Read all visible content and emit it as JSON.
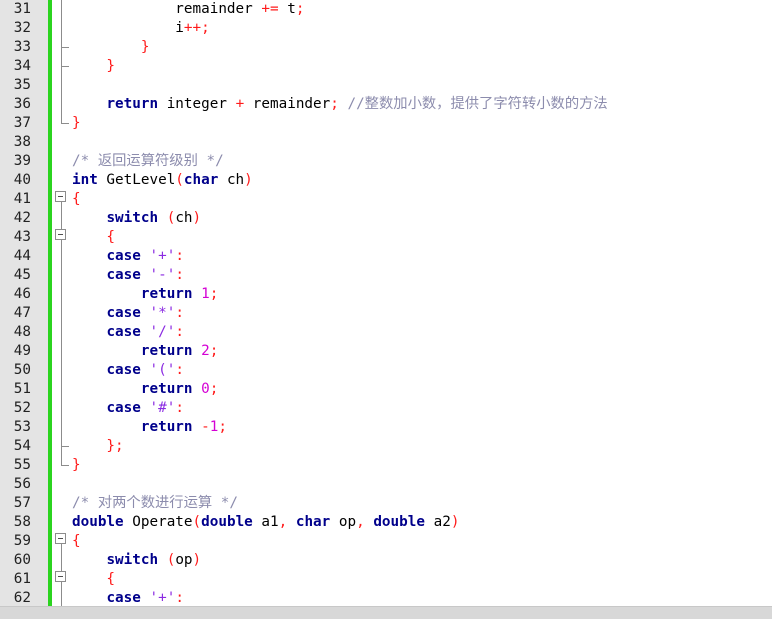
{
  "editor": {
    "lines": [
      {
        "n": "31",
        "t": [
          {
            "c": "",
            "v": "            remainder "
          },
          {
            "c": "op",
            "v": "+="
          },
          {
            "c": "",
            "v": " t"
          },
          {
            "c": "op",
            "v": ";"
          }
        ]
      },
      {
        "n": "32",
        "t": [
          {
            "c": "",
            "v": "            i"
          },
          {
            "c": "op",
            "v": "++;"
          }
        ]
      },
      {
        "n": "33",
        "t": [
          {
            "c": "op",
            "v": "        }"
          }
        ]
      },
      {
        "n": "34",
        "t": [
          {
            "c": "op",
            "v": "    }"
          }
        ]
      },
      {
        "n": "35",
        "t": []
      },
      {
        "n": "36",
        "t": [
          {
            "c": "",
            "v": "    "
          },
          {
            "c": "kw",
            "v": "return"
          },
          {
            "c": "",
            "v": " integer "
          },
          {
            "c": "op",
            "v": "+"
          },
          {
            "c": "",
            "v": " remainder"
          },
          {
            "c": "op",
            "v": ";"
          },
          {
            "c": "cm",
            "v": " //整数加小数，提供了字符转小数的方法"
          }
        ]
      },
      {
        "n": "37",
        "t": [
          {
            "c": "op",
            "v": "}"
          }
        ]
      },
      {
        "n": "38",
        "t": []
      },
      {
        "n": "39",
        "t": [
          {
            "c": "cm",
            "v": "/* 返回运算符级别 */"
          }
        ]
      },
      {
        "n": "40",
        "t": [
          {
            "c": "kw",
            "v": "int"
          },
          {
            "c": "",
            "v": " GetLevel"
          },
          {
            "c": "op",
            "v": "("
          },
          {
            "c": "kw",
            "v": "char"
          },
          {
            "c": "",
            "v": " ch"
          },
          {
            "c": "op",
            "v": ")"
          }
        ]
      },
      {
        "n": "41",
        "t": [
          {
            "c": "op",
            "v": "{"
          }
        ]
      },
      {
        "n": "42",
        "t": [
          {
            "c": "",
            "v": "    "
          },
          {
            "c": "kw",
            "v": "switch"
          },
          {
            "c": "",
            "v": " "
          },
          {
            "c": "op",
            "v": "("
          },
          {
            "c": "",
            "v": "ch"
          },
          {
            "c": "op",
            "v": ")"
          }
        ]
      },
      {
        "n": "43",
        "t": [
          {
            "c": "op",
            "v": "    {"
          }
        ]
      },
      {
        "n": "44",
        "t": [
          {
            "c": "",
            "v": "    "
          },
          {
            "c": "kw",
            "v": "case"
          },
          {
            "c": "",
            "v": " "
          },
          {
            "c": "str",
            "v": "'+'"
          },
          {
            "c": "op",
            "v": ":"
          }
        ]
      },
      {
        "n": "45",
        "t": [
          {
            "c": "",
            "v": "    "
          },
          {
            "c": "kw",
            "v": "case"
          },
          {
            "c": "",
            "v": " "
          },
          {
            "c": "str",
            "v": "'-'"
          },
          {
            "c": "op",
            "v": ":"
          }
        ]
      },
      {
        "n": "46",
        "t": [
          {
            "c": "",
            "v": "        "
          },
          {
            "c": "kw",
            "v": "return"
          },
          {
            "c": "",
            "v": " "
          },
          {
            "c": "num",
            "v": "1"
          },
          {
            "c": "op",
            "v": ";"
          }
        ]
      },
      {
        "n": "47",
        "t": [
          {
            "c": "",
            "v": "    "
          },
          {
            "c": "kw",
            "v": "case"
          },
          {
            "c": "",
            "v": " "
          },
          {
            "c": "str",
            "v": "'*'"
          },
          {
            "c": "op",
            "v": ":"
          }
        ]
      },
      {
        "n": "48",
        "t": [
          {
            "c": "",
            "v": "    "
          },
          {
            "c": "kw",
            "v": "case"
          },
          {
            "c": "",
            "v": " "
          },
          {
            "c": "str",
            "v": "'/'"
          },
          {
            "c": "op",
            "v": ":"
          }
        ]
      },
      {
        "n": "49",
        "t": [
          {
            "c": "",
            "v": "        "
          },
          {
            "c": "kw",
            "v": "return"
          },
          {
            "c": "",
            "v": " "
          },
          {
            "c": "num",
            "v": "2"
          },
          {
            "c": "op",
            "v": ";"
          }
        ]
      },
      {
        "n": "50",
        "t": [
          {
            "c": "",
            "v": "    "
          },
          {
            "c": "kw",
            "v": "case"
          },
          {
            "c": "",
            "v": " "
          },
          {
            "c": "str",
            "v": "'('"
          },
          {
            "c": "op",
            "v": ":"
          }
        ]
      },
      {
        "n": "51",
        "t": [
          {
            "c": "",
            "v": "        "
          },
          {
            "c": "kw",
            "v": "return"
          },
          {
            "c": "",
            "v": " "
          },
          {
            "c": "num",
            "v": "0"
          },
          {
            "c": "op",
            "v": ";"
          }
        ]
      },
      {
        "n": "52",
        "t": [
          {
            "c": "",
            "v": "    "
          },
          {
            "c": "kw",
            "v": "case"
          },
          {
            "c": "",
            "v": " "
          },
          {
            "c": "str",
            "v": "'#'"
          },
          {
            "c": "op",
            "v": ":"
          }
        ]
      },
      {
        "n": "53",
        "t": [
          {
            "c": "",
            "v": "        "
          },
          {
            "c": "kw",
            "v": "return"
          },
          {
            "c": "",
            "v": " "
          },
          {
            "c": "op",
            "v": "-"
          },
          {
            "c": "num",
            "v": "1"
          },
          {
            "c": "op",
            "v": ";"
          }
        ]
      },
      {
        "n": "54",
        "t": [
          {
            "c": "op",
            "v": "    };"
          }
        ]
      },
      {
        "n": "55",
        "t": [
          {
            "c": "op",
            "v": "}"
          }
        ]
      },
      {
        "n": "56",
        "t": []
      },
      {
        "n": "57",
        "t": [
          {
            "c": "cm",
            "v": "/* 对两个数进行运算 */"
          }
        ]
      },
      {
        "n": "58",
        "t": [
          {
            "c": "kw",
            "v": "double"
          },
          {
            "c": "",
            "v": " Operate"
          },
          {
            "c": "op",
            "v": "("
          },
          {
            "c": "kw",
            "v": "double"
          },
          {
            "c": "",
            "v": " a1"
          },
          {
            "c": "op",
            "v": ","
          },
          {
            "c": "",
            "v": " "
          },
          {
            "c": "kw",
            "v": "char"
          },
          {
            "c": "",
            "v": " op"
          },
          {
            "c": "op",
            "v": ","
          },
          {
            "c": "",
            "v": " "
          },
          {
            "c": "kw",
            "v": "double"
          },
          {
            "c": "",
            "v": " a2"
          },
          {
            "c": "op",
            "v": ")"
          }
        ]
      },
      {
        "n": "59",
        "t": [
          {
            "c": "op",
            "v": "{"
          }
        ]
      },
      {
        "n": "60",
        "t": [
          {
            "c": "",
            "v": "    "
          },
          {
            "c": "kw",
            "v": "switch"
          },
          {
            "c": "",
            "v": " "
          },
          {
            "c": "op",
            "v": "("
          },
          {
            "c": "",
            "v": "op"
          },
          {
            "c": "op",
            "v": ")"
          }
        ]
      },
      {
        "n": "61",
        "t": [
          {
            "c": "op",
            "v": "    {"
          }
        ]
      },
      {
        "n": "62",
        "t": [
          {
            "c": "",
            "v": "    "
          },
          {
            "c": "kw",
            "v": "case"
          },
          {
            "c": "",
            "v": " "
          },
          {
            "c": "str",
            "v": "'+'"
          },
          {
            "c": "op",
            "v": ":"
          }
        ]
      }
    ]
  },
  "colors": {
    "keyword": "#00008b",
    "operator": "#ff1a1a",
    "number": "#d400d4",
    "char_literal": "#8b2be2",
    "comment": "#8c8cad",
    "gutter": "#e4e4e4",
    "change_bar": "#2bd41f"
  }
}
